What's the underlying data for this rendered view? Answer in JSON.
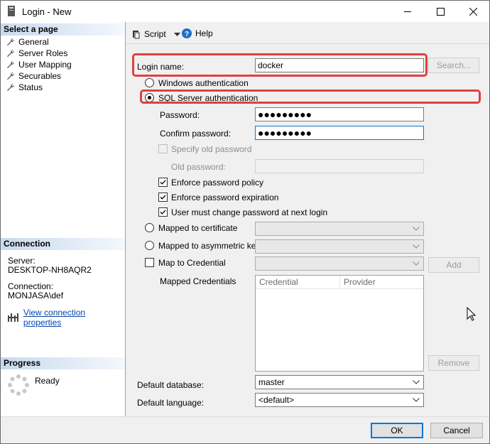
{
  "window": {
    "title": "Login - New"
  },
  "left": {
    "select_page": "Select a page",
    "pages": [
      {
        "label": "General"
      },
      {
        "label": "Server Roles"
      },
      {
        "label": "User Mapping"
      },
      {
        "label": "Securables"
      },
      {
        "label": "Status"
      }
    ],
    "connection_header": "Connection",
    "server_label": "Server:",
    "server_value": "DESKTOP-NH8AQR2",
    "connection_label": "Connection:",
    "connection_value": "MONJASA\\def",
    "view_connection": "View connection properties",
    "progress_header": "Progress",
    "progress_status": "Ready"
  },
  "toolbar": {
    "script": "Script",
    "help": "Help"
  },
  "form": {
    "login_name_label": "Login name:",
    "login_name_value": "docker",
    "search_button": "Search...",
    "windows_auth": "Windows authentication",
    "sql_auth": "SQL Server authentication",
    "password_label": "Password:",
    "password_value": "●●●●●●●●●",
    "confirm_label": "Confirm password:",
    "confirm_value": "●●●●●●●●●",
    "specify_old": "Specify old password",
    "old_password_label": "Old password:",
    "enforce_policy": "Enforce password policy",
    "enforce_expiration": "Enforce password expiration",
    "must_change": "User must change password at next login",
    "mapped_cert": "Mapped to certificate",
    "mapped_asym": "Mapped to asymmetric key",
    "map_credential": "Map to Credential",
    "add_button": "Add",
    "mapped_credentials": "Mapped Credentials",
    "grid_col_credential": "Credential",
    "grid_col_provider": "Provider",
    "remove_button": "Remove",
    "default_db_label": "Default database:",
    "default_db_value": "master",
    "default_lang_label": "Default language:",
    "default_lang_value": "<default>"
  },
  "buttons": {
    "ok": "OK",
    "cancel": "Cancel"
  },
  "colors": {
    "highlight": "#e0403f",
    "link": "#0645ad",
    "focus": "#0078d7"
  }
}
